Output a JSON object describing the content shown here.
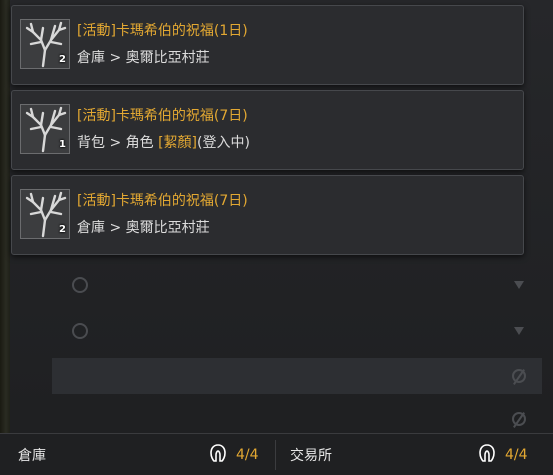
{
  "items": [
    {
      "title": "[活動]卡瑪希伯的祝福(1日)",
      "qty": "2",
      "loc_parts": [
        "倉庫 > 奧爾比亞村莊"
      ]
    },
    {
      "title": "[活動]卡瑪希伯的祝福(7日)",
      "qty": "1",
      "loc_prefix": "背包 > 角色 ",
      "loc_highlight": "[絜顏]",
      "loc_suffix": "(登入中)"
    },
    {
      "title": "[活動]卡瑪希伯的祝福(7日)",
      "qty": "2",
      "loc_parts": [
        "倉庫 > 奧爾比亞村莊"
      ]
    }
  ],
  "footer": {
    "left_label": "倉庫",
    "left_count": "4/4",
    "right_label": "交易所",
    "right_count": "4/4"
  },
  "icons": {
    "item_icon": "tree-icon",
    "footer_icon": "hood-icon"
  },
  "colors": {
    "title": "#e3a832",
    "text": "#dcdcdc",
    "panel": "#2b2c2f"
  }
}
